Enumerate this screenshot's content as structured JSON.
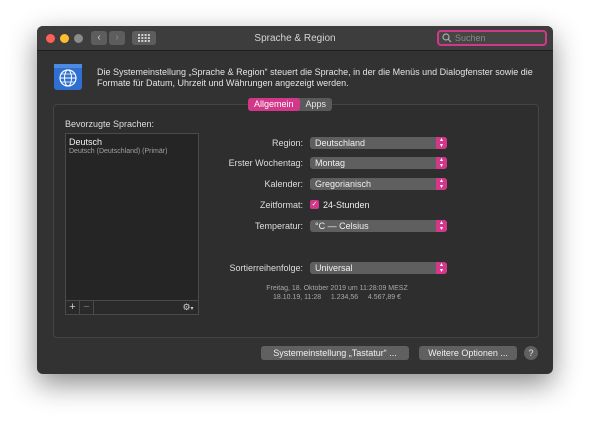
{
  "window": {
    "title": "Sprache & Region"
  },
  "search": {
    "placeholder": "Suchen"
  },
  "description": "Die Systemeinstellung „Sprache & Region“ steuert die Sprache, in der die Menüs und Dialogfenster sowie die Formate für Datum, Uhrzeit und Währungen angezeigt werden.",
  "tabs": [
    {
      "label": "Allgemein",
      "active": true
    },
    {
      "label": "Apps",
      "active": false
    }
  ],
  "preferred_languages": {
    "label": "Bevorzugte Sprachen:",
    "items": [
      {
        "name": "Deutsch",
        "detail": "Deutsch (Deutschland) (Primär)"
      }
    ]
  },
  "settings": {
    "region": {
      "label": "Region:",
      "value": "Deutschland"
    },
    "first_weekday": {
      "label": "Erster Wochentag:",
      "value": "Montag"
    },
    "calendar": {
      "label": "Kalender:",
      "value": "Gregorianisch"
    },
    "time_format": {
      "label": "Zeitformat:",
      "option": "24-Stunden",
      "checked": true
    },
    "temperature": {
      "label": "Temperatur:",
      "value": "°C — Celsius"
    },
    "sort_order": {
      "label": "Sortierreihenfolge:",
      "value": "Universal"
    }
  },
  "sample": {
    "line1": "Freitag, 18. Oktober 2019 um 11:28:09 MESZ",
    "line2": "18.10.19, 11:28     1.234,56     4.567,89 €"
  },
  "buttons": {
    "keyboard": "Systemeinstellung „Tastatur“ ...",
    "more_options": "Weitere Optionen ...",
    "help": "?"
  },
  "colors": {
    "accent": "#d2378a",
    "window_bg": "#323232"
  }
}
